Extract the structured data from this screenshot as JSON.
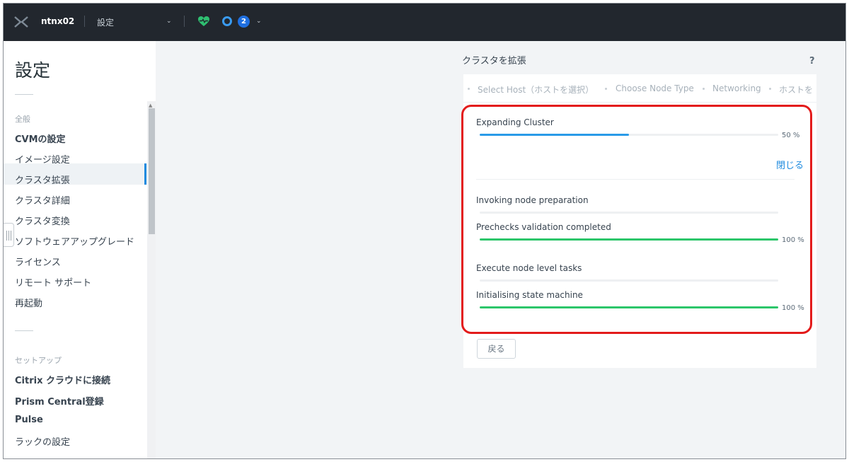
{
  "topbar": {
    "cluster_name": "ntnx02",
    "breadcrumb": "設定",
    "alert_count": "2"
  },
  "sidebar": {
    "title": "設定",
    "section_general": "全般",
    "items_general": [
      {
        "label": "CVMの設定",
        "bold": true
      },
      {
        "label": "イメージ設定"
      },
      {
        "label": "クラスタ拡張",
        "active": true
      },
      {
        "label": "クラスタ詳細"
      },
      {
        "label": "クラスタ変換"
      },
      {
        "label": "ソフトウェアアップグレード"
      },
      {
        "label": "ライセンス"
      },
      {
        "label": "リモート サポート"
      },
      {
        "label": "再起動"
      }
    ],
    "section_setup": "セットアップ",
    "items_setup": [
      {
        "label": "Citrix クラウドに接続",
        "bold": true
      },
      {
        "label": "Prism Central登録",
        "bold": true
      },
      {
        "label": "Pulse",
        "bold": true
      },
      {
        "label": "ラックの設定"
      }
    ]
  },
  "main": {
    "heading": "クラスタを拡張",
    "help": "?",
    "steps": [
      "Select Host（ホストを選択）",
      "Choose Node Type",
      "Networking",
      "ホストを"
    ],
    "overall": {
      "label": "Expanding Cluster",
      "percent_text": "50 %",
      "progress": 0.5
    },
    "close_label": "閉じる",
    "tasks": [
      {
        "label": "Invoking node preparation",
        "progress": 0,
        "percent_text": ""
      },
      {
        "label": "Prechecks validation completed",
        "progress": 1.0,
        "percent_text": "100 %"
      },
      {
        "label": "Execute node level tasks",
        "progress": 0,
        "percent_text": ""
      },
      {
        "label": "Initialising state machine",
        "progress": 1.0,
        "percent_text": "100 %"
      }
    ],
    "back_label": "戻る"
  },
  "colors": {
    "accent": "#1f8bdf",
    "progress_blue": "#2a9be8",
    "progress_green": "#2cc66a",
    "highlight_red": "#e31b1b",
    "topbar": "#22272e"
  }
}
